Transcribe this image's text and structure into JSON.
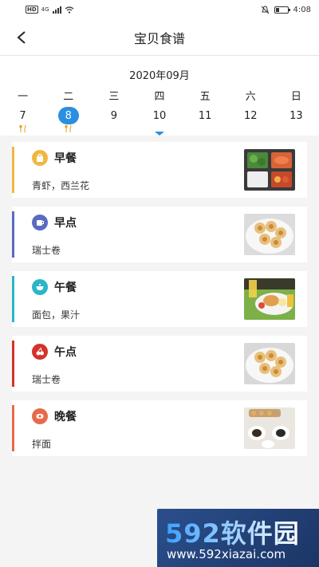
{
  "status_bar": {
    "hd": "HD",
    "network": "4G",
    "time": "4:08"
  },
  "nav": {
    "title": "宝贝食谱"
  },
  "calendar": {
    "month": "2020年09月",
    "weekdays": [
      "一",
      "二",
      "三",
      "四",
      "五",
      "六",
      "日"
    ],
    "dates": [
      "7",
      "8",
      "9",
      "10",
      "11",
      "12",
      "13"
    ],
    "selected_index": 1,
    "marked": [
      true,
      true,
      false,
      false,
      false,
      false,
      false
    ]
  },
  "meals": [
    {
      "name": "早餐",
      "foods": "青虾，西兰花",
      "color": "#f0b840",
      "icon": "bag-icon"
    },
    {
      "name": "早点",
      "foods": "瑞士卷",
      "color": "#5a6bbf",
      "icon": "cup-icon"
    },
    {
      "name": "午餐",
      "foods": "面包，果汁",
      "color": "#2bb5c8",
      "icon": "bowl-icon"
    },
    {
      "name": "午点",
      "foods": "瑞士卷",
      "color": "#d4322c",
      "icon": "fruit-icon"
    },
    {
      "name": "晚餐",
      "foods": "拌面",
      "color": "#e86a4a",
      "icon": "dish-icon"
    }
  ],
  "watermark": {
    "brand": "592软件园",
    "url": "www.592xiazai.com"
  }
}
